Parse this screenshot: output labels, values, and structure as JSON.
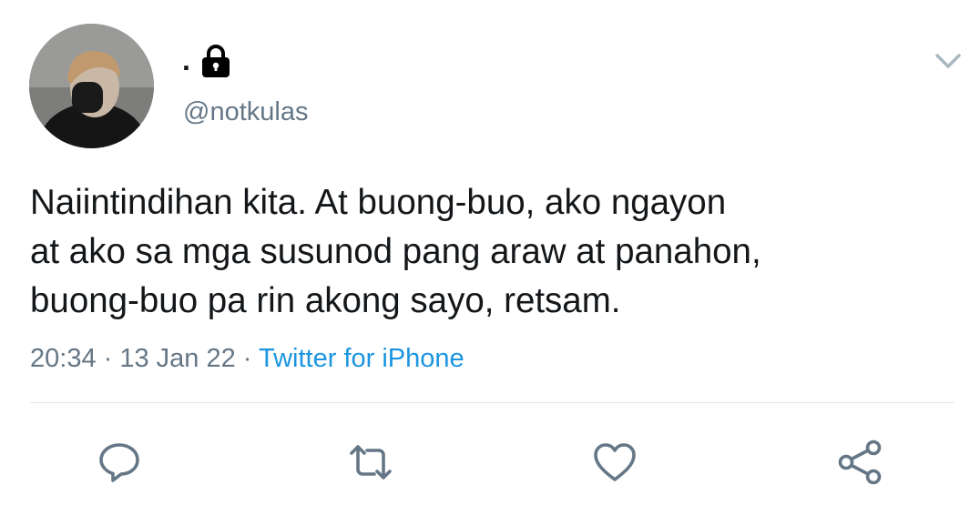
{
  "author": {
    "display_name": ".",
    "handle": "@notkulas",
    "protected": true,
    "avatar_icon": "profile-photo"
  },
  "tweet": {
    "text_lines": [
      "Naiintindihan kita. At buong-buo, ako ngayon",
      "at ako sa mga susunod pang araw at panahon,",
      "buong-buo pa rin akong sayo, retsam."
    ]
  },
  "meta": {
    "time": "20:34",
    "separator": " · ",
    "date": "13 Jan 22",
    "source": "Twitter for iPhone"
  },
  "actions": [
    {
      "icon": "reply-icon"
    },
    {
      "icon": "retweet-icon"
    },
    {
      "icon": "like-icon"
    },
    {
      "icon": "share-icon"
    }
  ],
  "colors": {
    "text": "#14171a",
    "secondary": "#657786",
    "link": "#1b95e0",
    "divider": "#e1e8ed",
    "icon": "#657786"
  }
}
